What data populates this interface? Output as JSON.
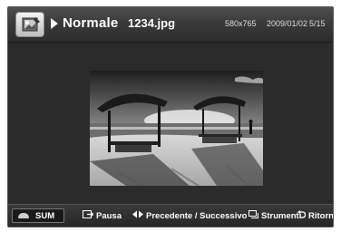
{
  "header": {
    "mode": "Normale",
    "filename": "1234.jpg",
    "resolution": "580x765",
    "date": "2009/01/02",
    "page": "5/15",
    "icon": "photo-album-icon"
  },
  "footer": {
    "sum": "SUM",
    "pause": "Pausa",
    "prev_next": "Precedente / Successivo",
    "tools": "Strumenti",
    "back": "Ritorno"
  },
  "colors": {
    "background": "#2b2b2b",
    "header_text": "#ffffff"
  }
}
